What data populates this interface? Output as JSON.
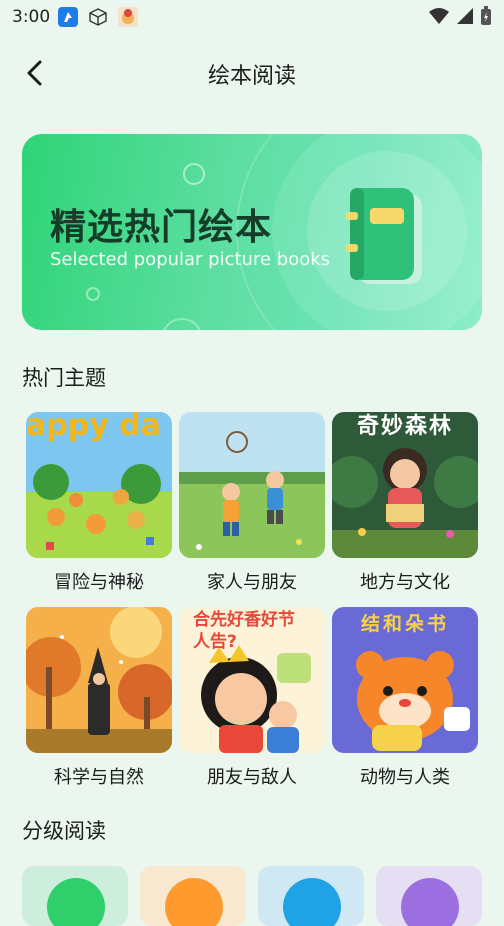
{
  "status_bar": {
    "time": "3:00",
    "app_icons": [
      "messenger-app-icon",
      "box-app-icon",
      "avatar-app-icon"
    ],
    "indicators": [
      "wifi-icon",
      "signal-icon",
      "battery-charging-icon"
    ]
  },
  "header": {
    "title": "绘本阅读",
    "back_icon": "chevron-left-icon"
  },
  "banner": {
    "title": "精选热门绘本",
    "subtitle": "Selected popular picture books",
    "illustration": "green-book-icon"
  },
  "hot_topics": {
    "title": "热门主题",
    "items": [
      {
        "label": "冒险与神秘",
        "cover_text": "appy da"
      },
      {
        "label": "家人与朋友",
        "cover_text": ""
      },
      {
        "label": "地方与文化",
        "cover_text": "奇妙森林"
      },
      {
        "label": "科学与自然",
        "cover_text": ""
      },
      {
        "label": "朋友与敌人",
        "cover_text": "合先好香好节人告?"
      },
      {
        "label": "动物与人类",
        "cover_text": "结和朵书"
      }
    ]
  },
  "graded_reading": {
    "title": "分级阅读",
    "levels": [
      {
        "color": "#2fcf6b",
        "bg": "#cdeedc"
      },
      {
        "color": "#ff9b2e",
        "bg": "#f7e8cf"
      },
      {
        "color": "#1fa3e6",
        "bg": "#cfe8f3"
      },
      {
        "color": "#9b6fe0",
        "bg": "#e6def3"
      }
    ]
  },
  "colors": {
    "background": "#eaf6ee",
    "accent": "#2ed477"
  }
}
